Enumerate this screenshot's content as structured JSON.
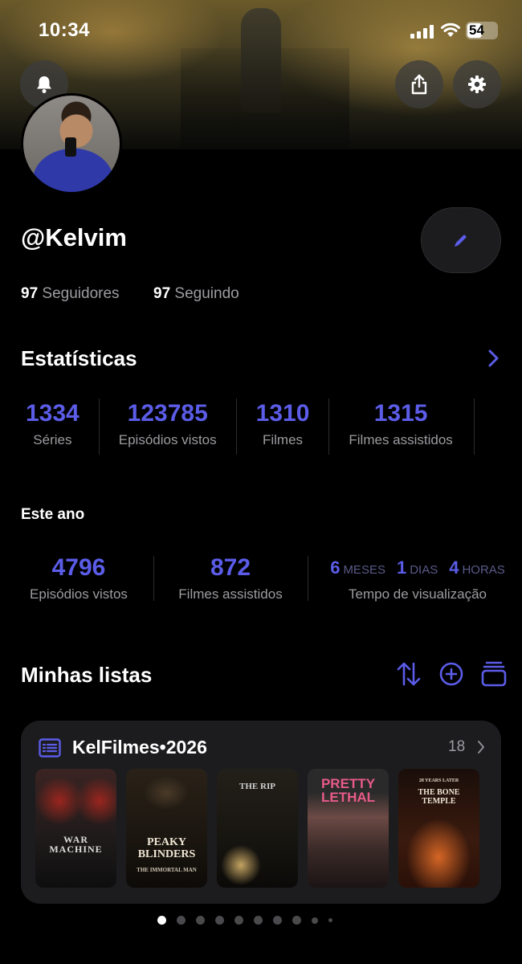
{
  "status_bar": {
    "time": "10:34",
    "battery": "54"
  },
  "profile": {
    "username": "@Kelvim",
    "followers_count": "97",
    "followers_label": "Seguidores",
    "following_count": "97",
    "following_label": "Seguindo"
  },
  "icons": {
    "notifications": "bell-icon",
    "share": "share-icon",
    "settings": "gear-icon",
    "edit": "pencil-icon"
  },
  "stats": {
    "title": "Estatísticas",
    "items": [
      {
        "value": "1334",
        "label": "Séries"
      },
      {
        "value": "123785",
        "label": "Episódios vistos"
      },
      {
        "value": "1310",
        "label": "Filmes"
      },
      {
        "value": "1315",
        "label": "Filmes assistidos"
      }
    ]
  },
  "this_year": {
    "title": "Este ano",
    "episodes": {
      "value": "4796",
      "label": "Episódios vistos"
    },
    "movies": {
      "value": "872",
      "label": "Filmes assistidos"
    },
    "watch_time": {
      "months": "6",
      "months_unit": "MESES",
      "days": "1",
      "days_unit": "DIAS",
      "hours": "4",
      "hours_unit": "HORAS",
      "label": "Tempo de visualização"
    }
  },
  "lists": {
    "title": "Minhas listas",
    "card": {
      "name": "KelFilmes•2026",
      "count": "18",
      "posters": [
        {
          "title": "WAR MACHINE"
        },
        {
          "title": "PEAKY BLINDERS",
          "subtitle": "THE IMMORTAL MAN"
        },
        {
          "title": "THE RIP"
        },
        {
          "title": "PRETTY LETHAL"
        },
        {
          "title": "THE BONE TEMPLE",
          "kicker": "28 YEARS LATER"
        }
      ]
    }
  },
  "pagination": {
    "pages": 10,
    "active": 1
  },
  "colors": {
    "accent": "#5b5ce8",
    "card": "#1c1c1e",
    "muted": "#9c9ca1"
  }
}
